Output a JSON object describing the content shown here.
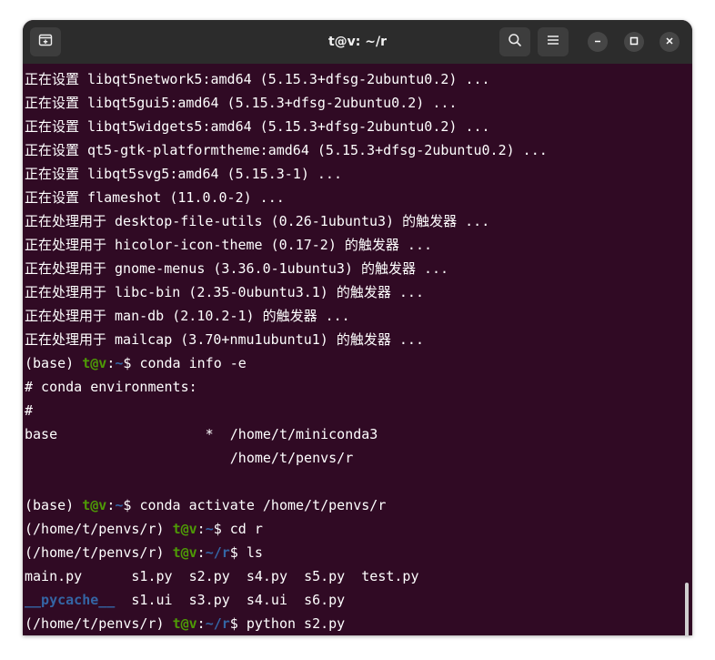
{
  "window": {
    "title": "t@v: ~/r"
  },
  "icons": {
    "new_tab": "new-tab-icon",
    "search": "search-icon",
    "menu": "hamburger-menu-icon",
    "minimize": "minimize-icon",
    "maximize": "maximize-icon",
    "close": "close-icon"
  },
  "colors": {
    "terminal_bg": "#300a24",
    "titlebar_bg": "#2c2c2c",
    "prompt_user": "#4e9a06",
    "prompt_path": "#3465a4",
    "text": "#ffffff"
  },
  "terminal": {
    "lines": [
      {
        "text": "正在设置 libqt5network5:amd64 (5.15.3+dfsg-2ubuntu0.2) ..."
      },
      {
        "text": "正在设置 libqt5gui5:amd64 (5.15.3+dfsg-2ubuntu0.2) ..."
      },
      {
        "text": "正在设置 libqt5widgets5:amd64 (5.15.3+dfsg-2ubuntu0.2) ..."
      },
      {
        "text": "正在设置 qt5-gtk-platformtheme:amd64 (5.15.3+dfsg-2ubuntu0.2) ..."
      },
      {
        "text": "正在设置 libqt5svg5:amd64 (5.15.3-1) ..."
      },
      {
        "text": "正在设置 flameshot (11.0.0-2) ..."
      },
      {
        "text": "正在处理用于 desktop-file-utils (0.26-1ubuntu3) 的触发器 ..."
      },
      {
        "text": "正在处理用于 hicolor-icon-theme (0.17-2) 的触发器 ..."
      },
      {
        "text": "正在处理用于 gnome-menus (3.36.0-1ubuntu3) 的触发器 ..."
      },
      {
        "text": "正在处理用于 libc-bin (2.35-0ubuntu3.1) 的触发器 ..."
      },
      {
        "text": "正在处理用于 man-db (2.10.2-1) 的触发器 ..."
      },
      {
        "text": "正在处理用于 mailcap (3.70+nmu1ubuntu1) 的触发器 ..."
      },
      {
        "prompt": {
          "env": "(base) ",
          "user": "t@v",
          "sep": ":",
          "path": "~",
          "end": "$ "
        },
        "text": "conda info -e"
      },
      {
        "text": "# conda environments:"
      },
      {
        "text": "#"
      },
      {
        "text": "base                  *  /home/t/miniconda3"
      },
      {
        "text": "                         /home/t/penvs/r"
      },
      {
        "text": ""
      },
      {
        "prompt": {
          "env": "(base) ",
          "user": "t@v",
          "sep": ":",
          "path": "~",
          "end": "$ "
        },
        "text": "conda activate /home/t/penvs/r"
      },
      {
        "prompt": {
          "env": "(/home/t/penvs/r) ",
          "user": "t@v",
          "sep": ":",
          "path": "~",
          "end": "$ "
        },
        "text": "cd r"
      },
      {
        "prompt": {
          "env": "(/home/t/penvs/r) ",
          "user": "t@v",
          "sep": ":",
          "path": "~/r",
          "end": "$ "
        },
        "text": "ls"
      },
      {
        "segments": [
          {
            "text": "main.py",
            "kind": "file"
          },
          {
            "text": "      ",
            "kind": "space"
          },
          {
            "text": "s1.py",
            "kind": "file"
          },
          {
            "text": "  ",
            "kind": "space"
          },
          {
            "text": "s2.py",
            "kind": "file"
          },
          {
            "text": "  ",
            "kind": "space"
          },
          {
            "text": "s4.py",
            "kind": "file"
          },
          {
            "text": "  ",
            "kind": "space"
          },
          {
            "text": "s5.py",
            "kind": "file"
          },
          {
            "text": "  ",
            "kind": "space"
          },
          {
            "text": "test.py",
            "kind": "file"
          }
        ]
      },
      {
        "segments": [
          {
            "text": "__pycache__",
            "kind": "dir"
          },
          {
            "text": "  ",
            "kind": "space"
          },
          {
            "text": "s1.ui",
            "kind": "file"
          },
          {
            "text": "  ",
            "kind": "space"
          },
          {
            "text": "s3.py",
            "kind": "file"
          },
          {
            "text": "  ",
            "kind": "space"
          },
          {
            "text": "s4.ui",
            "kind": "file"
          },
          {
            "text": "  ",
            "kind": "space"
          },
          {
            "text": "s6.py",
            "kind": "file"
          }
        ]
      },
      {
        "prompt": {
          "env": "(/home/t/penvs/r) ",
          "user": "t@v",
          "sep": ":",
          "path": "~/r",
          "end": "$ "
        },
        "text": "python s2.py"
      }
    ]
  }
}
